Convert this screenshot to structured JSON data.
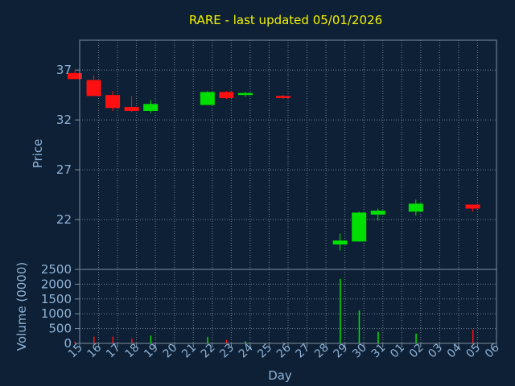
{
  "title": "RARE - last updated 05/01/2026",
  "colors": {
    "background": "#0e2035",
    "frame": "#7f8f9f",
    "grid": "#6f7f8f",
    "axis_text": "#8fb3d8",
    "title": "#f2f200",
    "up": "#00e000",
    "down": "#ff1010",
    "wick": "#d8d8d8"
  },
  "chart_data": {
    "type": "candlestick",
    "title": "RARE - last updated 05/01/2026",
    "xlabel": "Day",
    "x_ticks": [
      "15",
      "16",
      "17",
      "18",
      "19",
      "20",
      "21",
      "22",
      "23",
      "24",
      "25",
      "26",
      "27",
      "28",
      "29",
      "30",
      "31",
      "01",
      "02",
      "03",
      "04",
      "05",
      "06"
    ],
    "price_panel": {
      "ylabel": "Price",
      "ylim": [
        17,
        40
      ],
      "yticks": [
        22,
        27,
        32,
        37
      ],
      "grid": true
    },
    "volume_panel": {
      "ylabel": "Volume (0000)",
      "ylim": [
        0,
        2500
      ],
      "yticks": [
        0,
        500,
        1000,
        1500,
        2000,
        2500
      ],
      "grid": true
    },
    "candles": [
      {
        "day": "15",
        "open": 36.7,
        "high": 36.9,
        "low": 36.1,
        "close": 36.1,
        "volume": 60
      },
      {
        "day": "16",
        "open": 36.0,
        "high": 36.5,
        "low": 34.4,
        "close": 34.4,
        "volume": 230
      },
      {
        "day": "17",
        "open": 34.5,
        "high": 34.9,
        "low": 32.9,
        "close": 33.2,
        "volume": 230
      },
      {
        "day": "18",
        "open": 33.3,
        "high": 34.4,
        "low": 32.8,
        "close": 32.9,
        "volume": 160
      },
      {
        "day": "19",
        "open": 32.9,
        "high": 34.0,
        "low": 32.7,
        "close": 33.6,
        "volume": 260
      },
      {
        "day": "22",
        "open": 33.5,
        "high": 34.9,
        "low": 33.5,
        "close": 34.8,
        "volume": 220
      },
      {
        "day": "23",
        "open": 34.8,
        "high": 34.9,
        "low": 34.1,
        "close": 34.2,
        "volume": 120
      },
      {
        "day": "24",
        "open": 34.5,
        "high": 34.8,
        "low": 34.3,
        "close": 34.7,
        "volume": 70
      },
      {
        "day": "26",
        "open": 34.4,
        "high": 34.5,
        "low": 34.1,
        "close": 34.2,
        "volume": 40
      },
      {
        "day": "29",
        "open": 19.5,
        "high": 20.6,
        "low": 18.9,
        "close": 19.9,
        "volume": 2180
      },
      {
        "day": "30",
        "open": 19.8,
        "high": 22.8,
        "low": 19.8,
        "close": 22.7,
        "volume": 1120
      },
      {
        "day": "31",
        "open": 22.5,
        "high": 23.1,
        "low": 21.9,
        "close": 22.9,
        "volume": 390
      },
      {
        "day": "02",
        "open": 22.8,
        "high": 24.0,
        "low": 22.4,
        "close": 23.6,
        "volume": 330
      },
      {
        "day": "05",
        "open": 23.5,
        "high": 23.5,
        "low": 22.8,
        "close": 23.1,
        "volume": 460
      }
    ]
  }
}
